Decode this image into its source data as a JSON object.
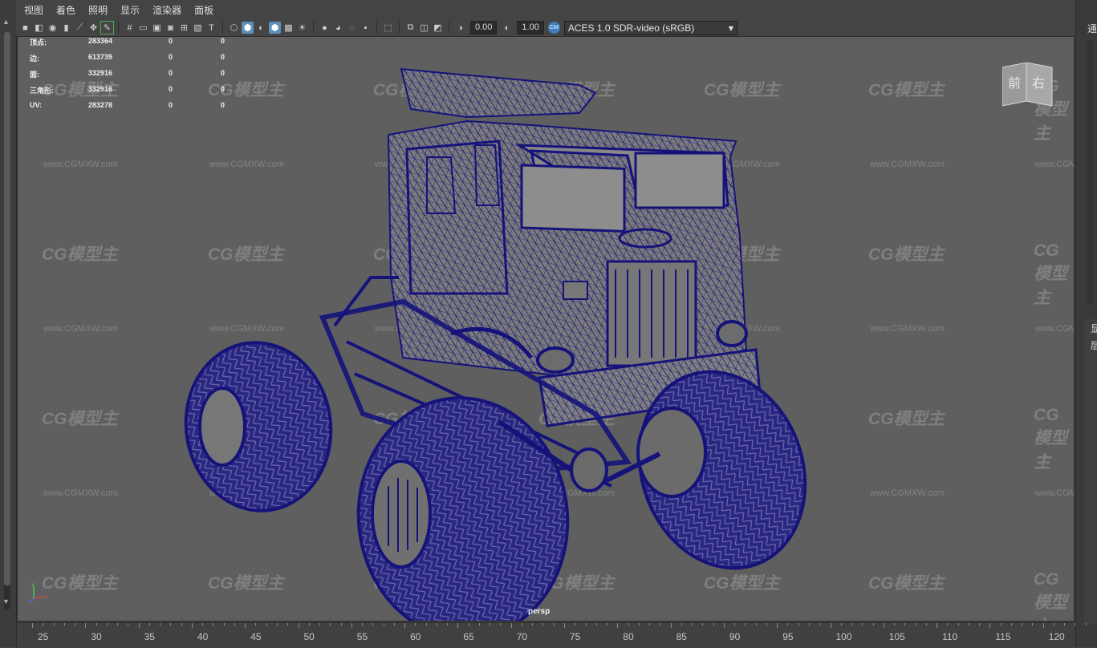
{
  "menubar": {
    "items": [
      "视图",
      "着色",
      "照明",
      "显示",
      "渲染器",
      "面板"
    ]
  },
  "toolbar": {
    "exposure_value": "0.00",
    "gamma_value": "1.00",
    "color_space": "ACES 1.0 SDR-video (sRGB)"
  },
  "stats": [
    {
      "label": "顶点:",
      "v1": "283364",
      "v2": "0",
      "v3": "0"
    },
    {
      "label": "边:",
      "v1": "613739",
      "v2": "0",
      "v3": "0"
    },
    {
      "label": "面:",
      "v1": "332916",
      "v2": "0",
      "v3": "0"
    },
    {
      "label": "三角形:",
      "v1": "332916",
      "v2": "0",
      "v3": "0"
    },
    {
      "label": "UV:",
      "v1": "283278",
      "v2": "0",
      "v3": "0"
    }
  ],
  "viewcube": {
    "front": "前",
    "right": "右"
  },
  "viewport": {
    "camera_label": "persp"
  },
  "watermark": {
    "logo": "CG模型主",
    "url": "www.CGMXW.com"
  },
  "right_panel": {
    "top_char": "通",
    "char_1": "显",
    "char_2": "层"
  },
  "timeline": {
    "ticks": [
      "25",
      "30",
      "35",
      "40",
      "45",
      "50",
      "55",
      "60",
      "65",
      "70",
      "75",
      "80",
      "85",
      "90",
      "95",
      "100",
      "105",
      "110",
      "115",
      "120"
    ]
  },
  "colors": {
    "wireframe": "#15137a",
    "viewport_bg": "#5f5f5f",
    "accent": "#5d8fb8"
  }
}
